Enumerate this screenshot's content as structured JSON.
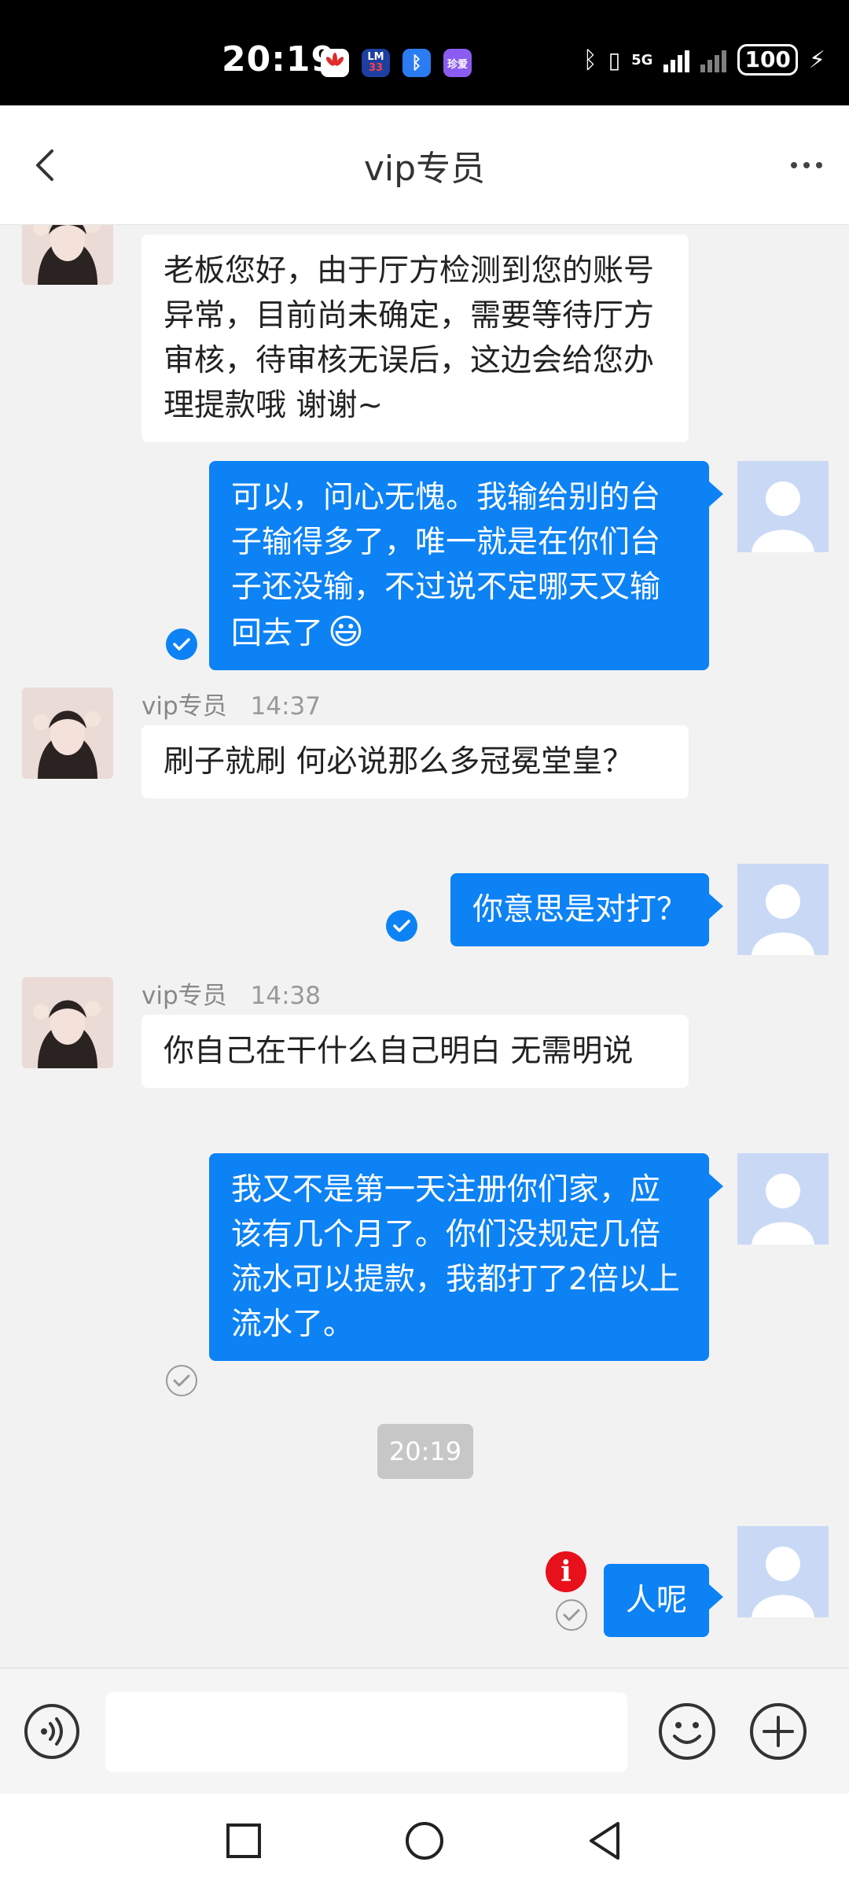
{
  "status_bar": {
    "time": "20:19",
    "apps": [
      {
        "icon": "huawei-app-icon",
        "label": "",
        "color": "#e02c2c"
      },
      {
        "icon": "badge-app-icon",
        "label": "33",
        "color": "#1d3fa0"
      },
      {
        "icon": "bluetooth-app-icon",
        "label": "",
        "color": "#2b7cf2"
      },
      {
        "icon": "zhenai-app-icon",
        "label": "珍爱",
        "color": "#8a5cf0"
      }
    ],
    "network": "5G",
    "battery": "100"
  },
  "header": {
    "title": "vip专员"
  },
  "messages": [
    {
      "side": "in",
      "text": "老板您好，由于厅方检测到您的账号异常，目前尚未确定，需要等待厅方审核，待审核无误后，这边会给您办理提款哦 谢谢~"
    },
    {
      "side": "out",
      "text": "可以，问心无愧。我输给别的台子输得多了，唯一就是在你们台子还没输，不过说不定哪天又输回去了",
      "emoji": "😃",
      "status": "read"
    },
    {
      "side": "in",
      "sender": "vip专员",
      "time": "14:37",
      "text": "刷子就刷 何必说那么多冠冕堂皇？"
    },
    {
      "side": "out",
      "text": "你意思是对打？",
      "status": "read"
    },
    {
      "side": "in",
      "sender": "vip专员",
      "time": "14:38",
      "text": "你自己在干什么自己明白  无需明说"
    },
    {
      "side": "out",
      "text": "我又不是第一天注册你们家，应该有几个月了。你们没规定几倍流水可以提款，我都打了2倍以上流水了。",
      "status": "sent"
    },
    {
      "side": "time",
      "text": "20:19"
    },
    {
      "side": "out",
      "text": "人呢",
      "status": "failed"
    }
  ],
  "colors": {
    "outgoing_bubble": "#0c82f5",
    "read_check": "#0c82f5",
    "error": "#e8101a"
  }
}
